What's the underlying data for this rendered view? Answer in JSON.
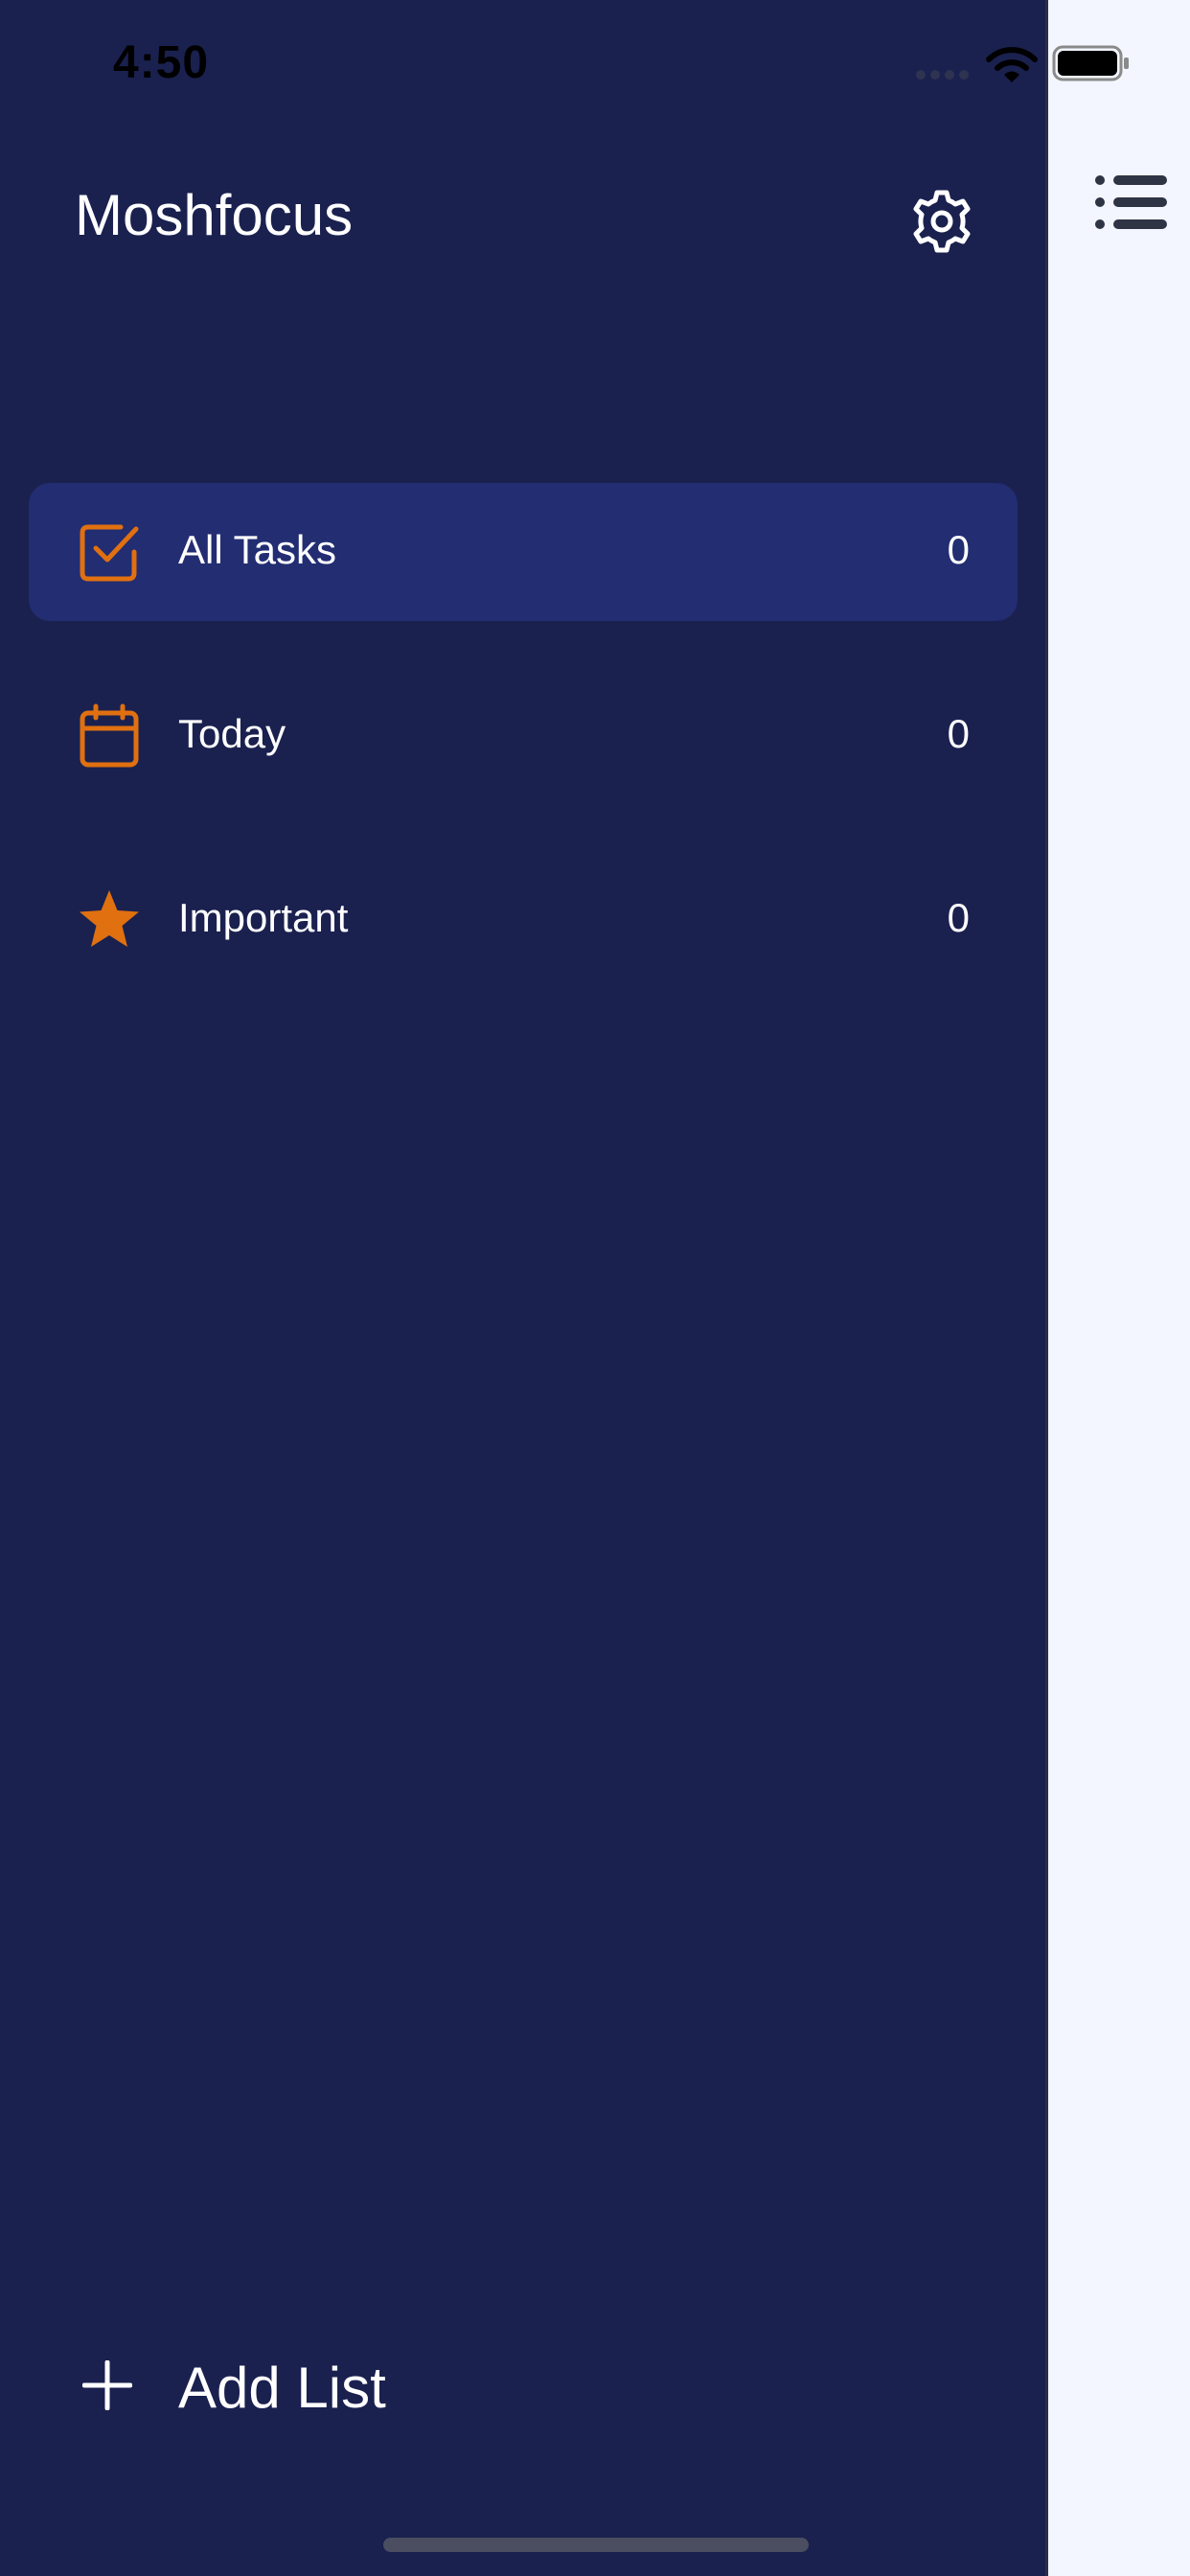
{
  "status_bar": {
    "time": "4:50",
    "icons": [
      "signal-dots-icon",
      "wifi-icon",
      "battery-icon"
    ]
  },
  "drawer": {
    "title": "Moshfocus",
    "settings_icon": "gear-icon",
    "items": [
      {
        "label": "All Tasks",
        "count": "0",
        "icon": "checkbox-icon",
        "active": true
      },
      {
        "label": "Today",
        "count": "0",
        "icon": "calendar-icon",
        "active": false
      },
      {
        "label": "Important",
        "count": "0",
        "icon": "star-icon",
        "active": false
      }
    ],
    "add_list_label": "Add List",
    "add_list_icon": "plus-icon"
  },
  "main": {
    "menu_icon": "list-menu-icon"
  },
  "colors": {
    "drawer_bg": "#1a214f",
    "active_item_bg": "#222d72",
    "accent": "#e07010",
    "right_pane_bg": "#f3f6ff"
  }
}
